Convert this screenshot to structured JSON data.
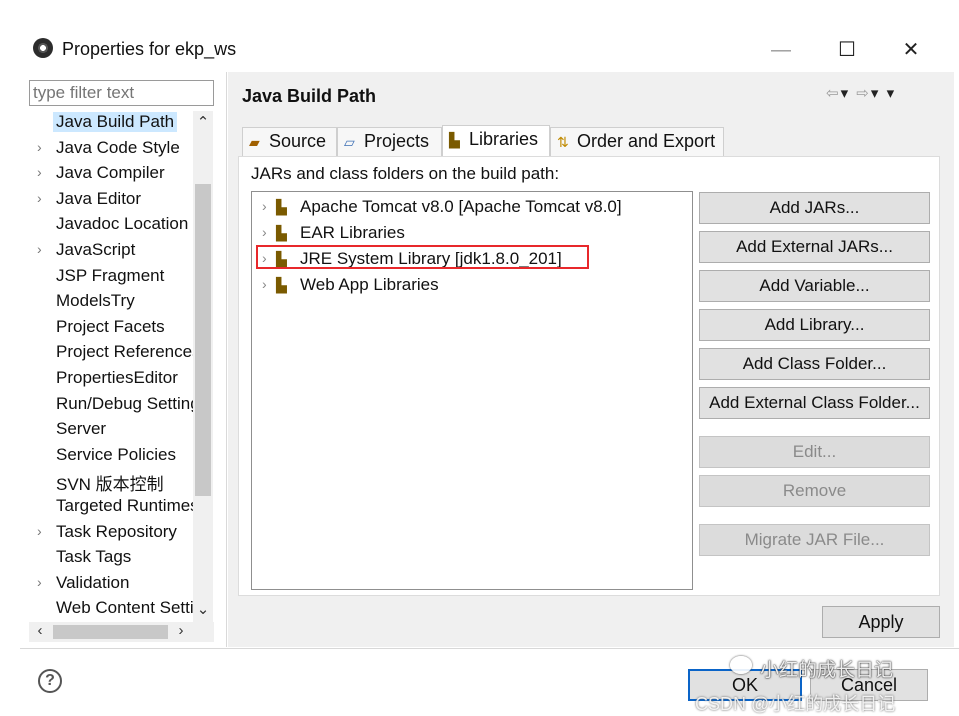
{
  "window": {
    "title": "Properties for ekp_ws",
    "min_glyph": "—",
    "max_glyph": "☐",
    "close_glyph": "✕"
  },
  "sidebar": {
    "filter_placeholder": "type filter text",
    "items": [
      {
        "label": "Java Build Path",
        "expandable": false,
        "selected": true
      },
      {
        "label": "Java Code Style",
        "expandable": true
      },
      {
        "label": "Java Compiler",
        "expandable": true
      },
      {
        "label": "Java Editor",
        "expandable": true
      },
      {
        "label": "Javadoc Location",
        "expandable": false
      },
      {
        "label": "JavaScript",
        "expandable": true
      },
      {
        "label": "JSP Fragment",
        "expandable": false
      },
      {
        "label": "ModelsTry",
        "expandable": false
      },
      {
        "label": "Project Facets",
        "expandable": false
      },
      {
        "label": "Project References",
        "expandable": false
      },
      {
        "label": "PropertiesEditor",
        "expandable": false
      },
      {
        "label": "Run/Debug Settings",
        "expandable": false
      },
      {
        "label": "Server",
        "expandable": false
      },
      {
        "label": "Service Policies",
        "expandable": false
      },
      {
        "label": "SVN 版本控制",
        "expandable": false
      },
      {
        "label": "Targeted Runtimes",
        "expandable": false
      },
      {
        "label": "Task Repository",
        "expandable": true
      },
      {
        "label": "Task Tags",
        "expandable": false
      },
      {
        "label": "Validation",
        "expandable": true
      },
      {
        "label": "Web Content Settings",
        "expandable": false
      }
    ]
  },
  "main": {
    "title": "Java Build Path",
    "tabs": [
      {
        "label": "Source",
        "icon": "source-folder-icon"
      },
      {
        "label": "Projects",
        "icon": "projects-folder-icon"
      },
      {
        "label": "Libraries",
        "icon": "libraries-icon",
        "active": true
      },
      {
        "label": "Order and Export",
        "icon": "order-export-icon"
      }
    ],
    "list_label": "JARs and class folders on the build path:",
    "libraries": [
      {
        "label": "Apache Tomcat v8.0 [Apache Tomcat v8.0]"
      },
      {
        "label": "EAR Libraries"
      },
      {
        "label": "JRE System Library [jdk1.8.0_201]",
        "highlighted": true
      },
      {
        "label": "Web App Libraries"
      }
    ],
    "buttons": [
      {
        "label": "Add JARs...",
        "enabled": true
      },
      {
        "label": "Add External JARs...",
        "enabled": true
      },
      {
        "label": "Add Variable...",
        "enabled": true
      },
      {
        "label": "Add Library...",
        "enabled": true
      },
      {
        "label": "Add Class Folder...",
        "enabled": true
      },
      {
        "label": "Add External Class Folder...",
        "enabled": true
      },
      {
        "label": "Edit...",
        "enabled": false
      },
      {
        "label": "Remove",
        "enabled": false
      },
      {
        "label": "Migrate JAR File...",
        "enabled": false
      }
    ],
    "apply_label": "Apply"
  },
  "footer": {
    "help_glyph": "?",
    "ok_label": "OK",
    "cancel_label": "Cancel"
  },
  "watermark": {
    "main": "小红的成长日记",
    "sub": "CSDN @小红的成长日记"
  },
  "colors": {
    "highlight_border": "#e8282b",
    "default_button_border": "#0a64c8",
    "selection": "#cce8ff"
  }
}
